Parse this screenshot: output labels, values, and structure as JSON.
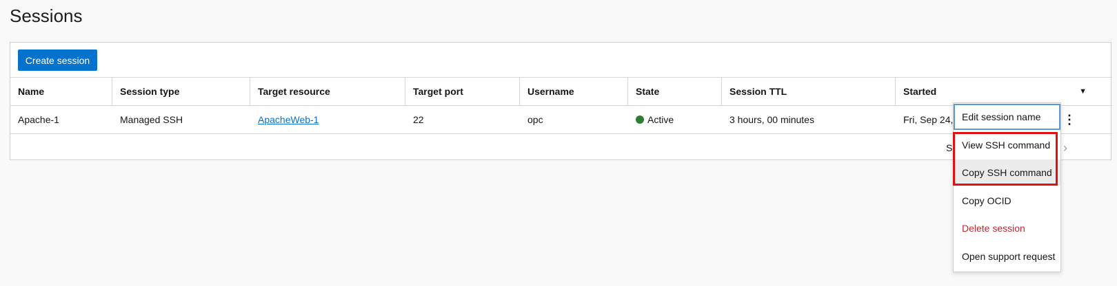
{
  "page": {
    "title": "Sessions"
  },
  "toolbar": {
    "create_label": "Create session"
  },
  "table": {
    "headers": [
      "Name",
      "Session type",
      "Target resource",
      "Target port",
      "Username",
      "State",
      "Session TTL",
      "Started"
    ],
    "rows": [
      {
        "name": "Apache-1",
        "session_type": "Managed SSH",
        "target_resource": "ApacheWeb-1",
        "target_port": "22",
        "username": "opc",
        "state": "Active",
        "session_ttl": "3 hours, 00 minutes",
        "started": "Fri, Sep 24, 20"
      }
    ],
    "footer_text": "S",
    "state_color": "#2d7d32"
  },
  "menu": {
    "items": [
      "Edit session name",
      "View SSH command",
      "Copy SSH command",
      "Copy OCID",
      "Delete session",
      "Open support request"
    ]
  },
  "colors": {
    "primary": "#0572ce",
    "danger": "#c1272d",
    "highlight": "#e01010"
  },
  "icons": {
    "sort": "caret-down-icon",
    "kebab": "kebab-menu-icon",
    "next": "chevron-right-icon"
  }
}
